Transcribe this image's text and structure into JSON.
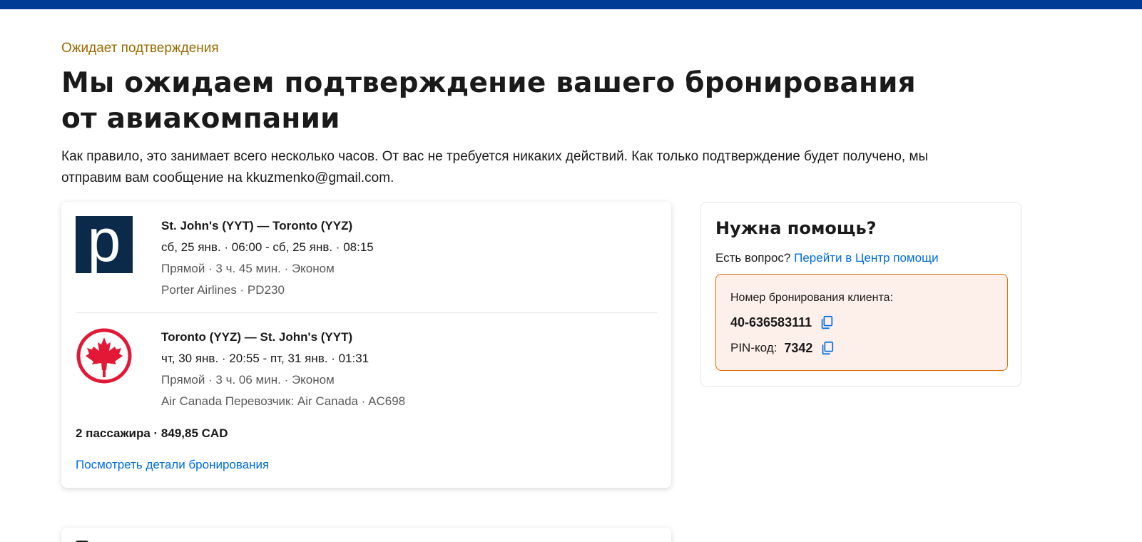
{
  "status": {
    "label": "Ожидает подтверждения"
  },
  "page": {
    "title": "Мы ожидаем подтверждение вашего бронирования от авиакомпании",
    "lead": "Как правило, это занимает всего несколько часов. От вас не требуется никаких действий. Как только подтверждение будет получено, мы отправим вам сообщение на kkuzmenko@gmail.com."
  },
  "trip": {
    "flights": [
      {
        "logo_icon": "porter-airlines-logo",
        "logo_letter": "p",
        "route": "St. John's (YYT) — Toronto (YYZ)",
        "times": "сб, 25 янв. · 06:00 - сб, 25 янв. · 08:15",
        "meta": "Прямой · 3 ч. 45 мин. · Эконом",
        "airline": "Porter Airlines · PD230"
      },
      {
        "logo_icon": "air-canada-logo",
        "route": "Toronto (YYZ) — St. John's (YYT)",
        "times": "чт, 30 янв. · 20:55 - пт, 31 янв. · 01:31",
        "meta": "Прямой · 3 ч. 06 мин. · Эконом",
        "airline": "Air Canada Перевозчик: Air Canada · AC698"
      }
    ],
    "summary": "2 пассажира · 849,85 CAD",
    "details_link": "Посмотреть детали бронирования"
  },
  "help": {
    "title": "Нужна помощь?",
    "question": "Есть вопрос? ",
    "link": "Перейти в Центр помощи",
    "booking_label": "Номер бронирования клиента:",
    "booking_number": "40-636583111",
    "pin_label": "PIN-код:",
    "pin_value": "7342"
  },
  "colors": {
    "brand": "#003b95",
    "link": "#006ce4",
    "status": "#9a6a00",
    "highlight_border": "#e36c09",
    "highlight_bg": "#fdf0ea"
  }
}
